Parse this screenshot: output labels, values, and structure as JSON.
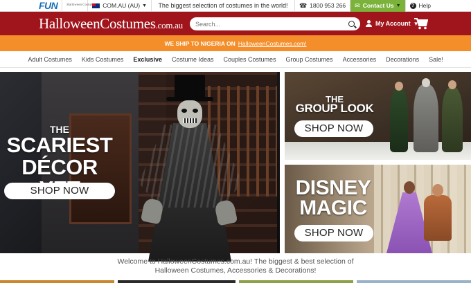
{
  "utility_bar": {
    "logo_fun": "FUN",
    "logo_halloween": "Halloween Costumes",
    "region": "COM.AU (AU)",
    "tagline": "The biggest selection of costumes in the world!",
    "phone": "1800 953 266",
    "contact": "Contact Us",
    "help": "Help",
    "colors": {
      "contact_bg": "#7ab23a"
    }
  },
  "header": {
    "brand": "HalloweenCostumes",
    "brand_suffix": ".com.au",
    "search_placeholder": "Search...",
    "account_label": "My Account",
    "colors": {
      "background": "#a0151c"
    }
  },
  "shipping": {
    "text": "WE SHIP TO NIGERIA ON",
    "link": "HalloweenCostumes.com!",
    "colors": {
      "background": "#f48e2a"
    }
  },
  "nav": {
    "items": [
      "Adult Costumes",
      "Kids Costumes",
      "Exclusive",
      "Costume Ideas",
      "Couples Costumes",
      "Group Costumes",
      "Accessories",
      "Decorations",
      "Sale!"
    ]
  },
  "banners": {
    "main": {
      "line_small": "THE",
      "line1": "SCARIEST",
      "line2": "DÉCOR YET",
      "cta": "SHOP NOW"
    },
    "group": {
      "line_small": "THE",
      "line1": "GROUP LOOK",
      "cta": "SHOP NOW"
    },
    "disney": {
      "line1": "DISNEY",
      "line2": "MAGIC",
      "cta": "SHOP NOW"
    }
  },
  "welcome": {
    "line1": "Welcome to HalloweenCostumes.com.au! The biggest & best selection of",
    "line2": "Halloween Costumes, Accessories & Decorations!"
  }
}
